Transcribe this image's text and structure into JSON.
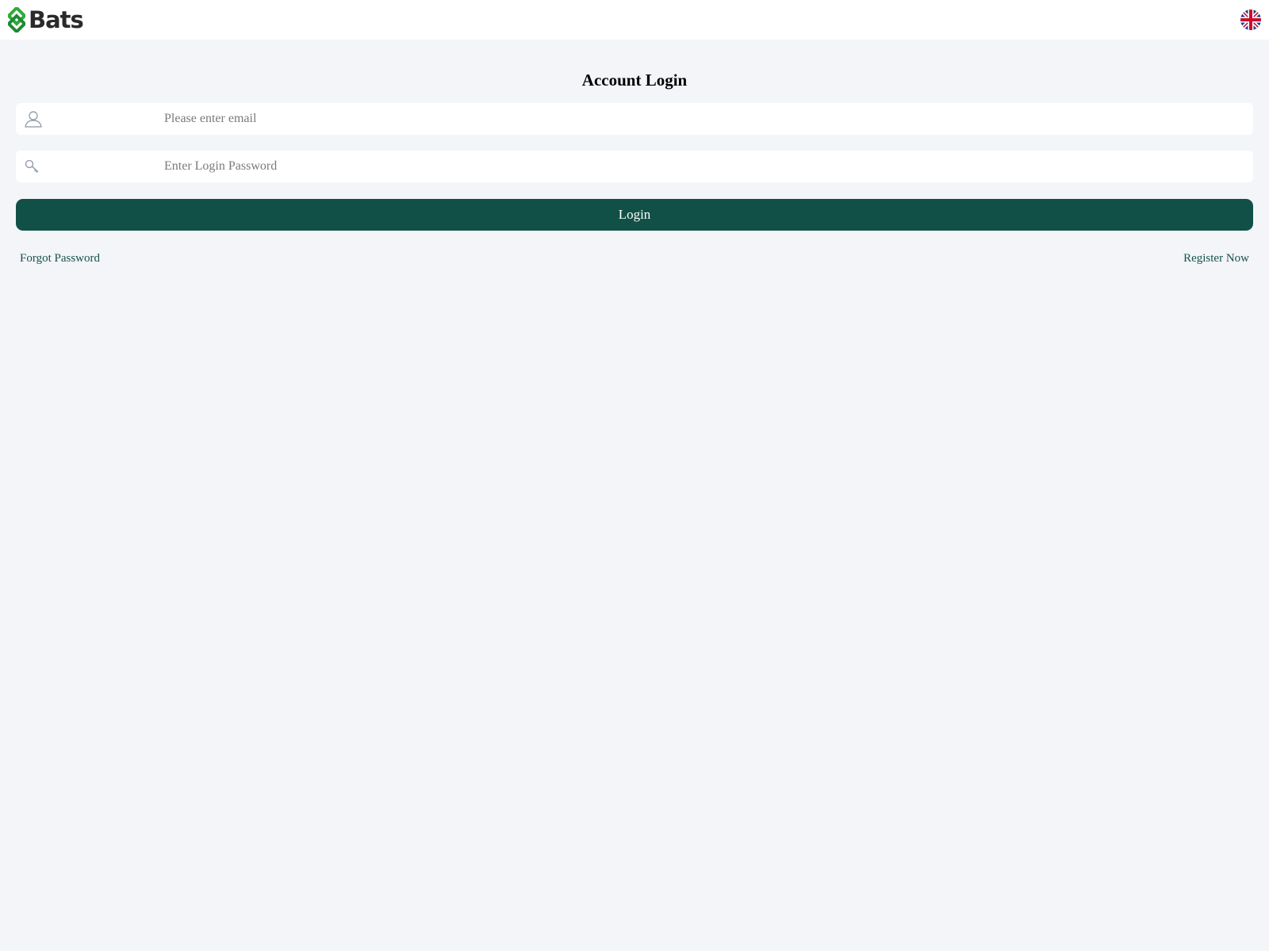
{
  "header": {
    "logo_text": "Bats",
    "language_icon": "uk-flag-icon"
  },
  "login": {
    "title": "Account Login",
    "email": {
      "icon": "user-icon",
      "value": "",
      "placeholder": "Please enter email"
    },
    "password": {
      "icon": "key-icon",
      "value": "",
      "placeholder": "Enter Login Password"
    },
    "submit_label": "Login",
    "forgot_label": "Forgot Password",
    "register_label": "Register Now"
  },
  "colors": {
    "background": "#f3f5f9",
    "primary": "#115046",
    "link": "#17524a",
    "logo_green": "#2eaa3c"
  }
}
